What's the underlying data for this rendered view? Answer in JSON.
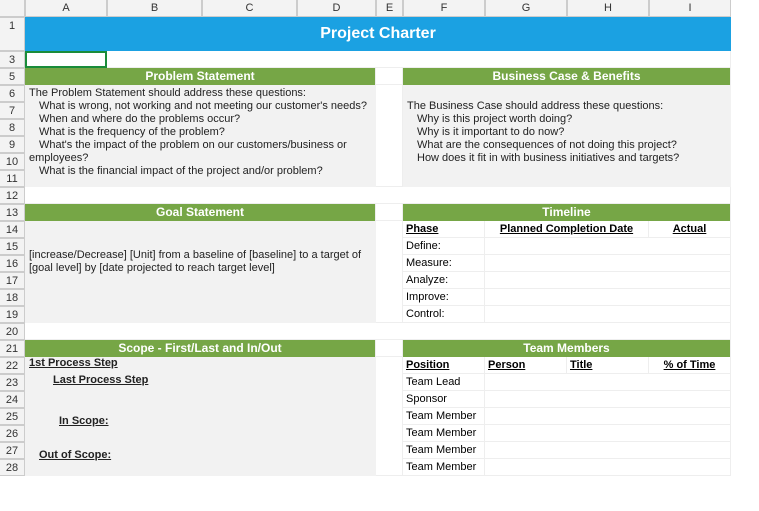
{
  "cols": [
    "A",
    "B",
    "C",
    "D",
    "E",
    "F",
    "G",
    "H",
    "I"
  ],
  "rows": [
    "1",
    "3",
    "5",
    "6",
    "7",
    "8",
    "9",
    "10",
    "11",
    "12",
    "13",
    "14",
    "15",
    "16",
    "17",
    "18",
    "19",
    "20",
    "21",
    "22",
    "23",
    "24",
    "25",
    "26",
    "27",
    "28"
  ],
  "title": "Project Charter",
  "sections": {
    "problem": "Problem Statement",
    "business": "Business Case & Benefits",
    "goal": "Goal Statement",
    "timeline": "Timeline",
    "scope": "Scope - First/Last and In/Out",
    "team": "Team Members"
  },
  "problem_text": "The Problem Statement should address these questions:",
  "problem_items": [
    "What is wrong, not working and not meeting our customer's needs?",
    "When and where do the problems occur?",
    "What is the frequency of the problem?",
    "What's the impact of the problem on our customers/business or employees?",
    "What is the financial impact of the project and/or problem?"
  ],
  "business_text": "The Business Case should address these questions:",
  "business_items": [
    "Why is this project worth doing?",
    "Why is it important to do now?",
    "What are the consequences of not doing this project?",
    "How does it fit in with business initiatives and targets?"
  ],
  "goal_text": "[increase/Decrease] [Unit] from a baseline of [baseline] to a target of [goal level] by [date projected to reach target level]",
  "timeline": {
    "h_phase": "Phase",
    "h_planned": "Planned Completion Date",
    "h_actual": "Actual",
    "phases": [
      "Define:",
      "Measure:",
      "Analyze:",
      "Improve:",
      "Control:"
    ]
  },
  "scope": {
    "first": "1st Process Step",
    "last": "Last Process Step",
    "in": "In Scope:",
    "out": "Out of Scope:"
  },
  "team": {
    "h_position": "Position",
    "h_person": "Person",
    "h_title": "Title",
    "h_pct": "% of Time",
    "positions": [
      "Team Lead",
      "Sponsor",
      "Team Member",
      "Team Member",
      "Team Member",
      "Team Member"
    ]
  }
}
